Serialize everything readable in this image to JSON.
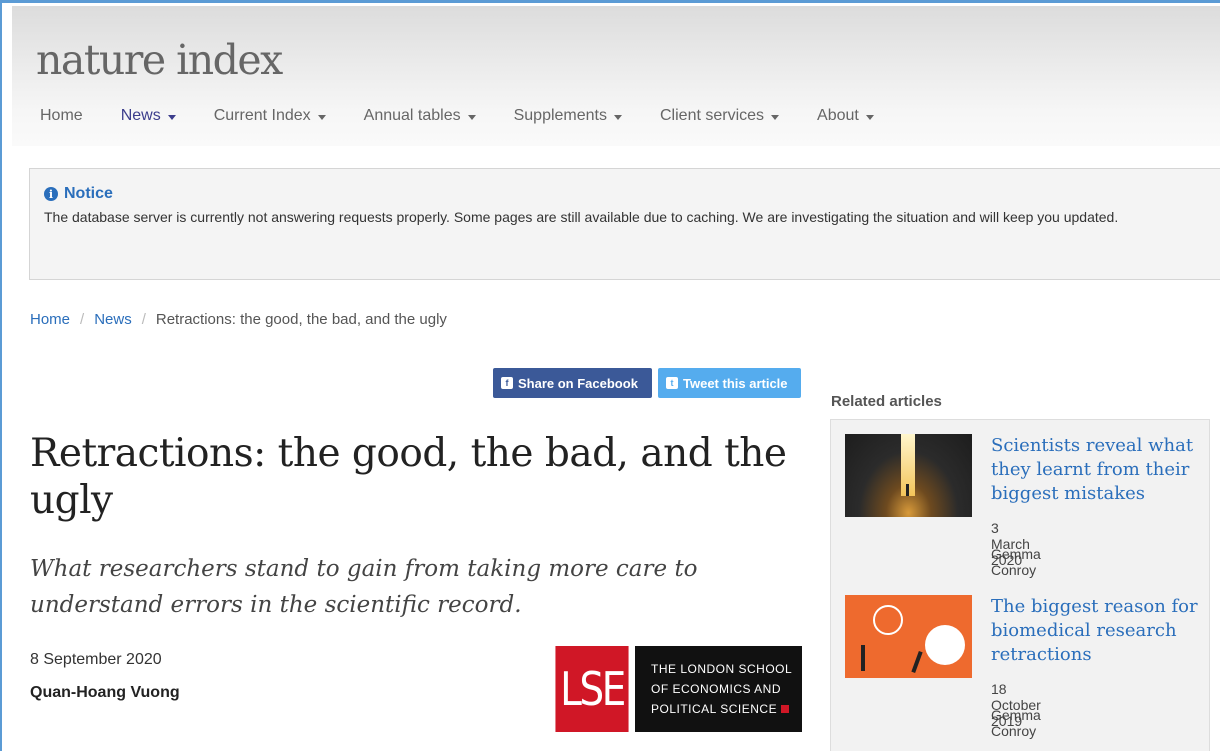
{
  "header": {
    "logo": "nature index",
    "nav": [
      {
        "label": "Home",
        "dropdown": false,
        "active": false
      },
      {
        "label": "News",
        "dropdown": true,
        "active": true
      },
      {
        "label": "Current Index",
        "dropdown": true,
        "active": false
      },
      {
        "label": "Annual tables",
        "dropdown": true,
        "active": false
      },
      {
        "label": "Supplements",
        "dropdown": true,
        "active": false
      },
      {
        "label": "Client services",
        "dropdown": true,
        "active": false
      },
      {
        "label": "About",
        "dropdown": true,
        "active": false
      }
    ]
  },
  "notice": {
    "icon": "info-circle-icon",
    "title": "Notice",
    "text": "The database server is currently not answering requests properly. Some pages are still available due to caching. We are investigating the situation and will keep you updated."
  },
  "breadcrumb": {
    "home": "Home",
    "news": "News",
    "current": "Retractions: the good, the bad, and the ugly",
    "separator": "/"
  },
  "share": {
    "facebook_label": "Share on Facebook",
    "twitter_label": "Tweet this article"
  },
  "article": {
    "title": "Retractions: the good, the bad, and the ugly",
    "standfirst": "What researchers stand to gain from taking more care to understand errors in the scientific record.",
    "date": "8 September 2020",
    "author": "Quan-Hoang Vuong"
  },
  "lse_logo": {
    "mark": "LSE",
    "line1": "THE LONDON SCHOOL",
    "line2": "OF ECONOMICS AND",
    "line3": "POLITICAL SCIENCE"
  },
  "related": {
    "heading": "Related articles",
    "items": [
      {
        "title": "Scientists reveal what they learnt from their biggest mistakes",
        "date": "3 March 2020",
        "author": "Gemma Conroy"
      },
      {
        "title": "The biggest reason for biomedical research retractions",
        "date": "18 October 2019",
        "author": "Gemma Conroy"
      }
    ]
  },
  "colors": {
    "link": "#2a6ebb",
    "nav_active": "#3c3d8c",
    "facebook": "#3b5998",
    "twitter": "#55acee",
    "lse_red": "#d01726"
  }
}
